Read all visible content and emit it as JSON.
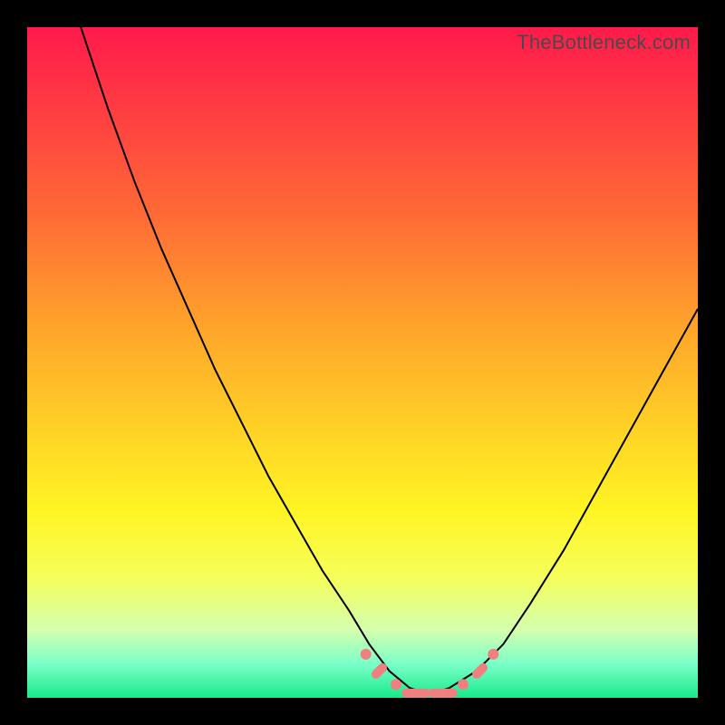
{
  "watermark": "TheBottleneck.com",
  "chart_data": {
    "type": "line",
    "title": "",
    "xlabel": "",
    "ylabel": "",
    "xlim": [
      0,
      100
    ],
    "ylim": [
      0,
      100
    ],
    "series": [
      {
        "name": "bottleneck-curve",
        "x": [
          8,
          12,
          16,
          20,
          24,
          28,
          32,
          36,
          40,
          44,
          48,
          51,
          54,
          57,
          60,
          63,
          67,
          71,
          75,
          80,
          85,
          90,
          95,
          100
        ],
        "y": [
          100,
          88,
          77,
          67,
          58,
          49,
          41,
          33,
          26,
          19,
          13,
          8,
          4,
          1.5,
          0.5,
          1.5,
          4,
          8,
          14,
          22,
          31,
          40,
          49,
          58
        ]
      }
    ],
    "markers": {
      "name": "trough-markers",
      "color": "#f08080",
      "points": [
        {
          "x": 50.5,
          "y": 6.5,
          "kind": "dot"
        },
        {
          "x": 52.5,
          "y": 4.0,
          "kind": "dash"
        },
        {
          "x": 55.0,
          "y": 2.0,
          "kind": "dot"
        },
        {
          "x": 58.0,
          "y": 0.7,
          "kind": "bar"
        },
        {
          "x": 62.0,
          "y": 0.7,
          "kind": "bar"
        },
        {
          "x": 65.0,
          "y": 2.0,
          "kind": "dot"
        },
        {
          "x": 67.5,
          "y": 4.0,
          "kind": "dash"
        },
        {
          "x": 69.5,
          "y": 6.5,
          "kind": "dot"
        }
      ]
    },
    "gradient_stops": [
      {
        "pos": 0,
        "color": "#ff1a4b"
      },
      {
        "pos": 12,
        "color": "#ff3c42"
      },
      {
        "pos": 28,
        "color": "#ff6a36"
      },
      {
        "pos": 45,
        "color": "#ffa52a"
      },
      {
        "pos": 60,
        "color": "#ffd226"
      },
      {
        "pos": 72,
        "color": "#fff423"
      },
      {
        "pos": 82,
        "color": "#f6ff5a"
      },
      {
        "pos": 90,
        "color": "#d3ffb0"
      },
      {
        "pos": 95,
        "color": "#7affc8"
      },
      {
        "pos": 100,
        "color": "#18ea8a"
      }
    ]
  }
}
